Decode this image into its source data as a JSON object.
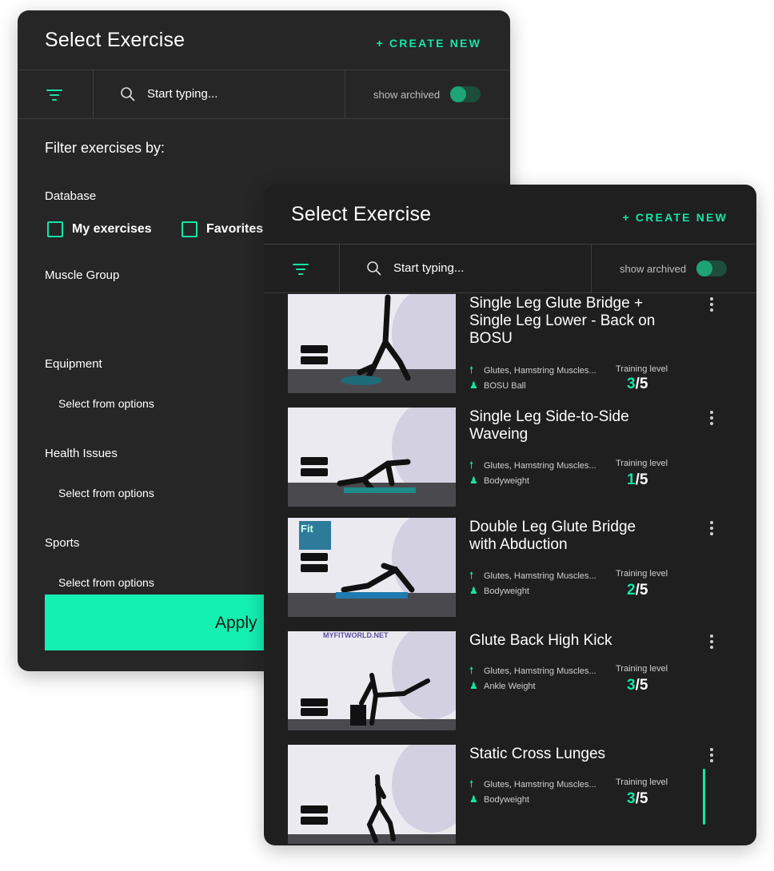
{
  "back_panel": {
    "title": "Select Exercise",
    "create_new": "+ CREATE NEW",
    "search_placeholder": "Start typing...",
    "show_archived": "show archived",
    "filter_heading": "Filter exercises by:",
    "database_label": "Database",
    "checkbox_my": "My exercises",
    "checkbox_fav": "Favorites",
    "muscle_group_label": "Muscle Group",
    "equipment_label": "Equipment",
    "equipment_option": "Select from options",
    "health_label": "Health Issues",
    "health_option": "Select from options",
    "sports_label": "Sports",
    "sports_option": "Select from options",
    "apply_label": "Apply"
  },
  "front_panel": {
    "title": "Select Exercise",
    "create_new": "+ CREATE NEW",
    "search_placeholder": "Start typing...",
    "show_archived": "show archived",
    "training_level_label": "Training level",
    "exercises": [
      {
        "name": "Single Leg Glute Bridge + Single Leg Lower - Back on BOSU",
        "muscles": "Glutes, Hamstring Muscles...",
        "equipment": "BOSU Ball",
        "level": "3",
        "max": "/5"
      },
      {
        "name": "Single Leg Side-to-Side Waveing",
        "muscles": "Glutes, Hamstring Muscles...",
        "equipment": "Bodyweight",
        "level": "1",
        "max": "/5"
      },
      {
        "name": "Double Leg Glute Bridge with Abduction",
        "muscles": "Glutes, Hamstring Muscles...",
        "equipment": "Bodyweight",
        "level": "2",
        "max": "/5"
      },
      {
        "name": "Glute Back High Kick",
        "muscles": "Glutes, Hamstring Muscles...",
        "equipment": "Ankle Weight",
        "level": "3",
        "max": "/5"
      },
      {
        "name": "Static Cross Lunges",
        "muscles": "Glutes, Hamstring Muscles...",
        "equipment": "Bodyweight",
        "level": "3",
        "max": "/5"
      }
    ]
  },
  "colors": {
    "accent": "#14e6a5",
    "panel": "#262626",
    "apply": "#14f0b1"
  },
  "icons": [
    "filter-icon",
    "search-icon",
    "muscle-icon",
    "equipment-icon",
    "more-icon",
    "checkbox-icon"
  ],
  "thumbnail_labels": {
    "item3_logo": "Fit",
    "item4_banner": "MYFITWORLD.NET"
  }
}
